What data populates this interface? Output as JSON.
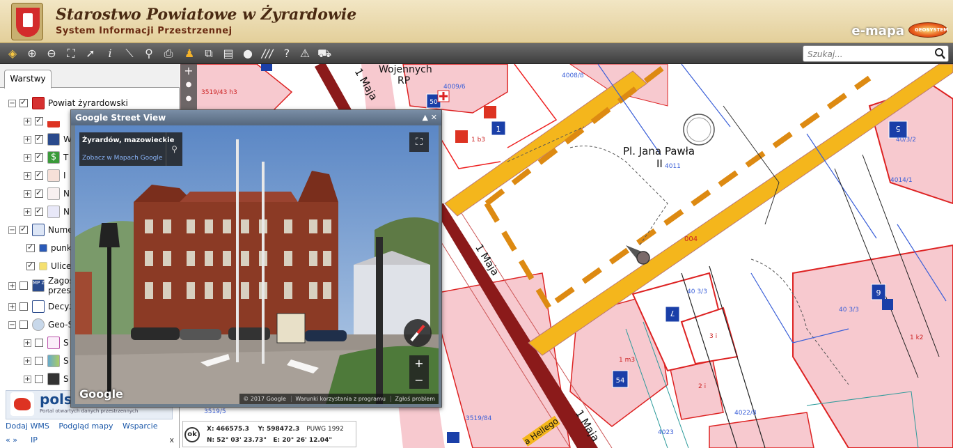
{
  "header": {
    "title": "Starostwo Powiatowe w Żyrardowie",
    "subtitle": "System Informacji Przestrzennej",
    "brand": "e-mapa",
    "geosys_badge": "GEOSYSTEM"
  },
  "toolbar": {
    "tools": [
      "layers-icon",
      "zoom-in-icon",
      "zoom-out-icon",
      "zoom-extent-icon",
      "select-arrow-icon",
      "info-icon",
      "measure-icon",
      "search-parcel-icon",
      "print-icon",
      "streetview-pegman-icon",
      "export-icon",
      "legend-icon",
      "comment-icon",
      "hatch-icon",
      "help-icon",
      "warning-icon",
      "cart-icon"
    ],
    "search_placeholder": "Szukaj..."
  },
  "leftpanel": {
    "tab": "Warstwy",
    "layers": [
      {
        "label": "Powiat żyrardowski",
        "expanded": true,
        "checked": true
      },
      {
        "label": "",
        "expanded": false,
        "checked": true
      },
      {
        "label": "W",
        "expanded": false,
        "checked": true
      },
      {
        "label": "T",
        "expanded": false,
        "checked": true
      },
      {
        "label": "I",
        "expanded": false,
        "checked": true
      },
      {
        "label": "N",
        "expanded": false,
        "checked": true
      },
      {
        "label": "N",
        "expanded": false,
        "checked": true
      },
      {
        "label": "Nume",
        "expanded": true,
        "checked": true
      },
      {
        "label": "punkt",
        "checked": true
      },
      {
        "label": "Ulice",
        "checked": true
      },
      {
        "label": "Zagos",
        "label2": "przes",
        "expanded": false,
        "checked": false
      },
      {
        "label": "Decyz",
        "expanded": false,
        "checked": false
      },
      {
        "label": "Geo-S",
        "expanded": true,
        "checked": false
      },
      {
        "label": "S",
        "expanded": false,
        "checked": false
      },
      {
        "label": "S",
        "expanded": false,
        "checked": false
      },
      {
        "label": "S",
        "expanded": false,
        "checked": false
      }
    ],
    "polska_name": "polsk",
    "polska_tagline": "Portal otwartych danych przestrzennych",
    "links": [
      "Dodaj WMS",
      "Podgląd mapy",
      "Wsparcie"
    ],
    "nav": "« »",
    "ip": "IP",
    "close": "x"
  },
  "map": {
    "labels": {
      "wojennych": "Wojennych",
      "rp": "RP",
      "plac": "Pl. Jana Pawła",
      "plac2": "II",
      "street1": "1 Maja",
      "street2": "1 Maja",
      "street3": "1 Maja",
      "street4": "1 Maja",
      "hellego": "a Hellego",
      "p4011": "4011",
      "p4008": "4008/8",
      "p4009": "4009/6",
      "p3519": "3519/43 h3",
      "p4013": "40/3/2",
      "p4014": "4014/1",
      "p4013b": "40 3/3",
      "p4013c": "40 3/3",
      "p4022": "4022/8",
      "p3519b": "3519/84",
      "p3519c": "3519/5",
      "p4023": "4023",
      "k2": "1 k2",
      "m3": "1 m3",
      "b3": "1 b3",
      "i2": "2 i",
      "i3": "3 i",
      "a004": "004"
    },
    "badges": [
      "5",
      "1",
      "7",
      "9",
      "54",
      "50"
    ],
    "zoom_plus": "+"
  },
  "coords": {
    "ok": "ok",
    "x": "X: 466575.3",
    "y": "Y: 598472.3",
    "system": "PUWG 1992",
    "n": "N: 52° 03' 23.73\"",
    "e": "E: 20° 26' 12.04\""
  },
  "streetview": {
    "title": "Google Street View",
    "controls": "▲ ✕",
    "location": "Żyrardów, mazowieckie",
    "link": "Zobacz w Mapach Google",
    "logo": "Google",
    "copyright": "© 2017 Google",
    "terms": "Warunki korzystania z programu",
    "report": "Zgłoś problem",
    "zoom_in": "+",
    "zoom_out": "−"
  }
}
